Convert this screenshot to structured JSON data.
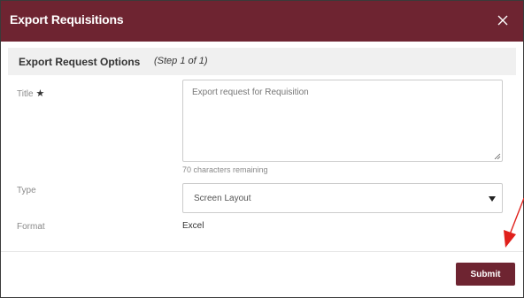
{
  "dialog": {
    "title": "Export Requisitions"
  },
  "section": {
    "title": "Export Request Options",
    "step": "(Step 1 of 1)"
  },
  "fields": {
    "title_label": "Title",
    "required_mark": "★",
    "title_value": "Export request for Requisition",
    "chars_remaining": "70 characters remaining",
    "type_label": "Type",
    "type_value": "Screen Layout",
    "format_label": "Format",
    "format_value": "Excel"
  },
  "footer": {
    "submit_label": "Submit"
  },
  "colors": {
    "brand": "#6e2431",
    "annotation": "#e0201b"
  }
}
